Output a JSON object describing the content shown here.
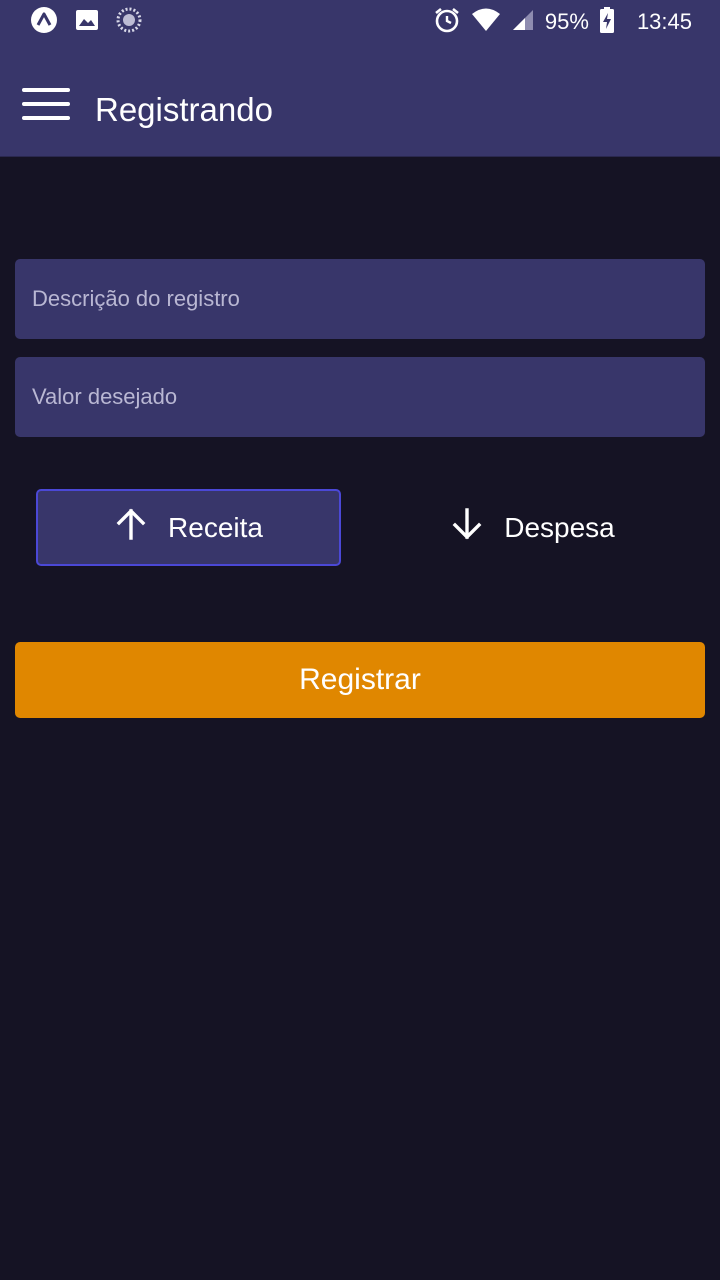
{
  "status_bar": {
    "battery_percent": "95%",
    "time": "13:45",
    "left_icons": [
      "app-notification-icon",
      "image-notification-icon",
      "sync-notification-icon"
    ],
    "right_icons": [
      "alarm-icon",
      "wifi-icon",
      "signal-icon",
      "battery-charging-icon"
    ]
  },
  "app_bar": {
    "title": "Registrando",
    "menu_icon": "hamburger-menu-icon"
  },
  "form": {
    "description_placeholder": "Descrição do registro",
    "description_value": "",
    "value_placeholder": "Valor desejado",
    "value_value": ""
  },
  "type_selector": {
    "income_label": "Receita",
    "income_icon": "arrow-up-icon",
    "expense_label": "Despesa",
    "expense_icon": "arrow-down-icon",
    "selected": "Receita"
  },
  "submit": {
    "label": "Registrar"
  },
  "colors": {
    "header_bg": "#38366a",
    "page_bg": "#151324",
    "input_bg": "#38366a",
    "selected_border": "#4b48d6",
    "button_bg": "#e08700",
    "text": "#ffffff",
    "placeholder": "#b9b7d3"
  }
}
